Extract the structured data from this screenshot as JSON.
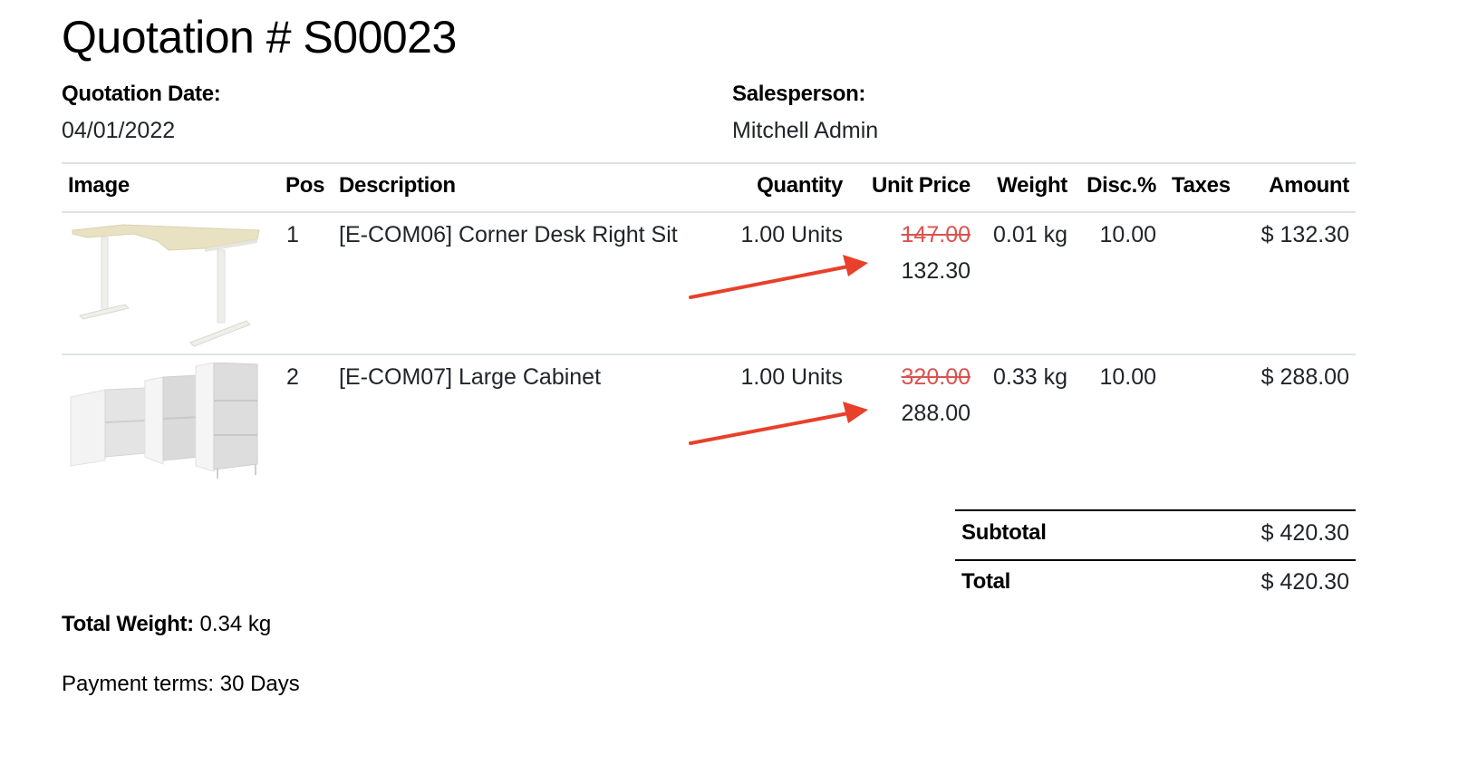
{
  "document": {
    "title": "Quotation # S00023",
    "quotation_date_label": "Quotation Date:",
    "quotation_date": "04/01/2022",
    "salesperson_label": "Salesperson:",
    "salesperson": "Mitchell Admin"
  },
  "table": {
    "headers": {
      "image": "Image",
      "pos": "Pos",
      "description": "Description",
      "quantity": "Quantity",
      "unit_price": "Unit Price",
      "weight": "Weight",
      "discount": "Disc.%",
      "taxes": "Taxes",
      "amount": "Amount"
    },
    "rows": [
      {
        "image": "corner-desk-image",
        "pos": "1",
        "description": "[E-COM06] Corner Desk Right Sit",
        "quantity": "1.00 Units",
        "original_price": "147.00",
        "discounted_price": "132.30",
        "weight": "0.01 kg",
        "discount": "10.00",
        "taxes": "",
        "amount": "$ 132.30"
      },
      {
        "image": "large-cabinet-image",
        "pos": "2",
        "description": "[E-COM07] Large Cabinet",
        "quantity": "1.00 Units",
        "original_price": "320.00",
        "discounted_price": "288.00",
        "weight": "0.33 kg",
        "discount": "10.00",
        "taxes": "",
        "amount": "$ 288.00"
      }
    ]
  },
  "totals": {
    "subtotal_label": "Subtotal",
    "subtotal": "$ 420.30",
    "total_label": "Total",
    "total": "$ 420.30"
  },
  "footer": {
    "total_weight_label": "Total Weight:",
    "total_weight": " 0.34 kg",
    "payment_terms": "Payment terms: 30 Days"
  },
  "annotations": {
    "arrow_color": "#e8402a",
    "strike_color": "#d9534f"
  }
}
